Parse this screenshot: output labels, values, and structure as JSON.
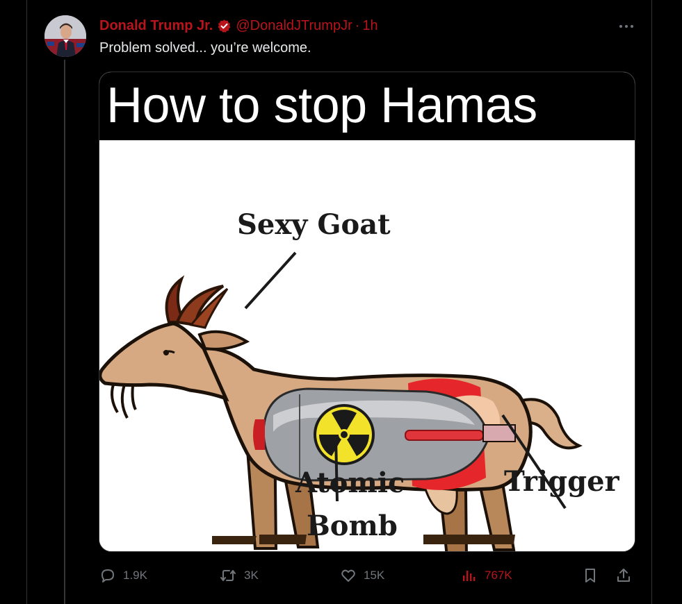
{
  "tweet": {
    "display_name": "Donald Trump Jr.",
    "handle": "@DonaldJTrumpJr",
    "separator": "·",
    "time": "1h",
    "text": "Problem solved... you’re welcome."
  },
  "media": {
    "title": "How to stop Hamas",
    "labels": {
      "goat": "Sexy Goat",
      "atomic": "Atomic",
      "bomb": "Bomb",
      "trigger": "Trigger"
    }
  },
  "actions": {
    "replies": "1.9K",
    "reposts": "3K",
    "likes": "15K",
    "views": "767K"
  },
  "icons": {
    "verified": "verified-badge-icon",
    "more": "more-icon",
    "reply": "reply-icon",
    "repost": "repost-icon",
    "like": "heart-icon",
    "views": "analytics-icon",
    "bookmark": "bookmark-icon",
    "share": "share-icon"
  },
  "colors": {
    "accent": "#b8141b",
    "text": "#e7e9ea",
    "muted": "#71767b",
    "background": "#000000"
  }
}
